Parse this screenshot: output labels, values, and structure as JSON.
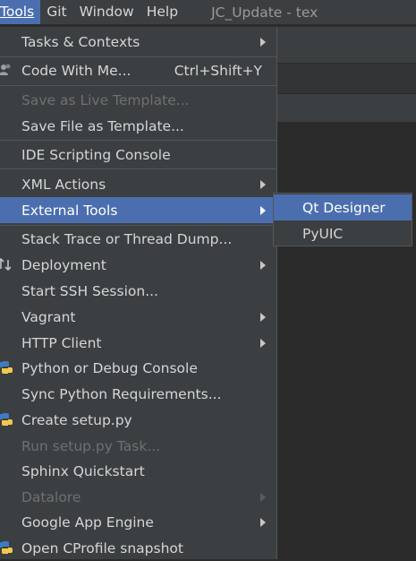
{
  "menubar": {
    "items": [
      {
        "label": "Tools",
        "mnemonic_index": 0
      },
      {
        "label": "Git",
        "mnemonic_index": 0
      },
      {
        "label": "Window",
        "mnemonic_index": 0
      },
      {
        "label": "Help",
        "mnemonic_index": 0
      }
    ],
    "window_title": "JC_Update - tex"
  },
  "tools_menu": {
    "items": [
      {
        "label": "Tasks & Contexts",
        "submenu": true,
        "enabled": true
      },
      {
        "label": "Code With Me...",
        "shortcut": "Ctrl+Shift+Y",
        "icon": "code-with-me-icon",
        "enabled": true
      },
      {
        "label": "Save as Live Template...",
        "enabled": false
      },
      {
        "label": "Save File as Template...",
        "enabled": true
      },
      {
        "label": "IDE Scripting Console",
        "enabled": true
      },
      {
        "label": "XML Actions",
        "submenu": true,
        "enabled": true
      },
      {
        "label": "External Tools",
        "submenu": true,
        "enabled": true,
        "selected": true
      },
      {
        "label": "Stack Trace or Thread Dump...",
        "enabled": true
      },
      {
        "label": "Deployment",
        "submenu": true,
        "icon": "deployment-icon",
        "enabled": true
      },
      {
        "label": "Start SSH Session...",
        "enabled": true
      },
      {
        "label": "Vagrant",
        "submenu": true,
        "enabled": true
      },
      {
        "label": "HTTP Client",
        "submenu": true,
        "enabled": true
      },
      {
        "label": "Python or Debug Console",
        "icon": "python-icon",
        "enabled": true
      },
      {
        "label": "Sync Python Requirements...",
        "enabled": true
      },
      {
        "label": "Create setup.py",
        "icon": "python-icon",
        "enabled": true
      },
      {
        "label": "Run setup.py Task...",
        "enabled": false
      },
      {
        "label": "Sphinx Quickstart",
        "enabled": true
      },
      {
        "label": "Datalore",
        "submenu": true,
        "enabled": false
      },
      {
        "label": "Google App Engine",
        "submenu": true,
        "enabled": true
      },
      {
        "label": "Open CProfile snapshot",
        "icon": "python-icon",
        "enabled": true
      }
    ]
  },
  "external_tools_submenu": {
    "items": [
      {
        "label": "Qt Designer",
        "selected": true
      },
      {
        "label": "PyUIC"
      }
    ]
  },
  "colors": {
    "selection": "#4b6eaf",
    "menu_bg": "#3c3f41",
    "disabled_text": "#6e7072"
  }
}
